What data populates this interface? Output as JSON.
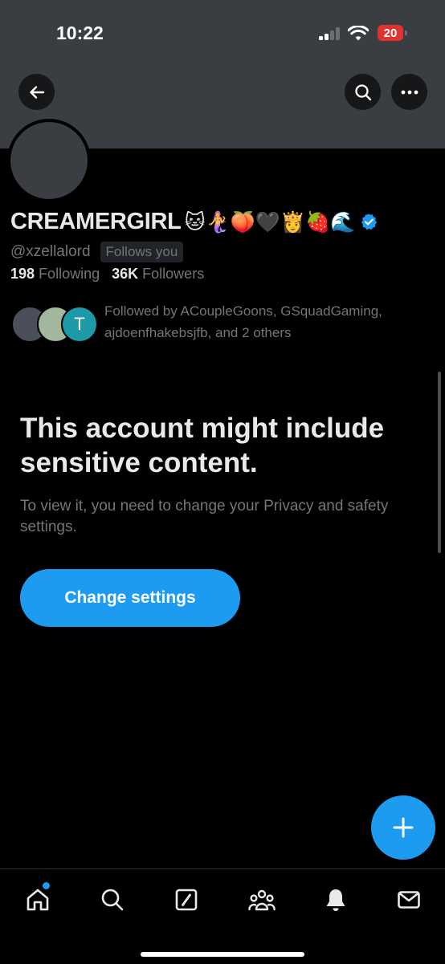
{
  "status_bar": {
    "time": "10:22",
    "battery_level": "20",
    "battery_color": "#e0332f"
  },
  "header": {
    "back_icon": "arrow-left-icon",
    "search_icon": "search-icon",
    "more_icon": "ellipsis-icon"
  },
  "profile": {
    "display_name": "CREAMERGIRL",
    "name_emojis": "🐱🧜‍♀️🍑🖤👸🍓🌊",
    "verified": true,
    "handle": "@xzellalord",
    "follows_you_badge": "Follows you",
    "following_count": "198",
    "following_label": "Following",
    "followers_count": "36K",
    "followers_label": "Followers",
    "followed_by_text": "Followed by ACoupleGoons, GSquadGaming, ajdoenfhakebsjfb, and 2 others",
    "followed_by_avatars": [
      {
        "initial": "",
        "color": "#4b4f5a"
      },
      {
        "initial": "",
        "color": "#a3b79d"
      },
      {
        "initial": "T",
        "color": "#1c9aa7"
      }
    ]
  },
  "notice": {
    "headline": "This account might include sensitive content.",
    "description": "To view it, you need to change your Privacy and safety settings.",
    "button_label": "Change settings"
  },
  "fab": {
    "icon": "plus-icon"
  },
  "tab_bar": {
    "items": [
      {
        "icon": "home-icon",
        "has_notification_dot": true
      },
      {
        "icon": "search-icon"
      },
      {
        "icon": "grok-icon"
      },
      {
        "icon": "communities-icon"
      },
      {
        "icon": "bell-icon"
      },
      {
        "icon": "mail-icon"
      }
    ]
  },
  "colors": {
    "accent": "#1d9bf0",
    "background": "#000000",
    "banner": "#3a3d41"
  }
}
